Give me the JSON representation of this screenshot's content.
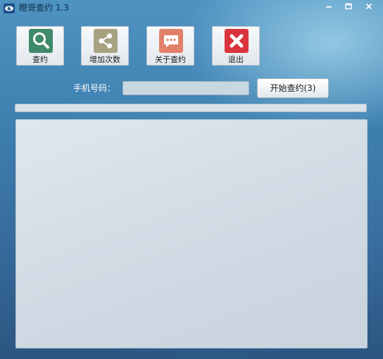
{
  "window": {
    "title": "瞪哥查约 1.3"
  },
  "toolbar": {
    "query_label": "查约",
    "add_count_label": "增加次数",
    "about_label": "关于查约",
    "exit_label": "退出",
    "icons": {
      "query": "search-icon",
      "add_count": "share-icon",
      "about": "chat-bubble-icon",
      "exit": "close-x-icon"
    },
    "icon_colors": {
      "query": "#3f8a6a",
      "add_count": "#a8a282",
      "about": "#e3806a",
      "exit": "#d9343c"
    }
  },
  "form": {
    "phone_label": "手机号码：",
    "phone_value": "",
    "start_button_label": "开始查约(3)"
  },
  "progress": {
    "value_percent": 0
  },
  "output": {
    "text": ""
  }
}
